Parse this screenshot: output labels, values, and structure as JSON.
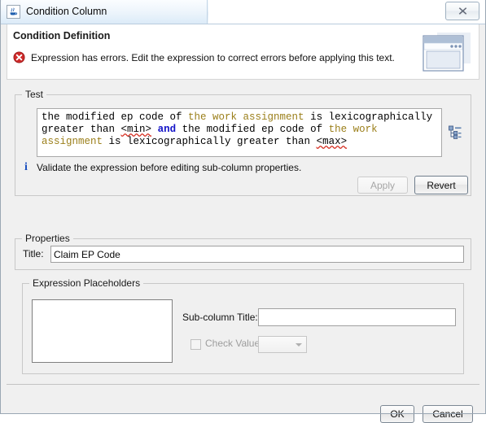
{
  "window": {
    "title": "Condition Column",
    "app_icon": "java-coffee-cup-icon",
    "close_label": "✖"
  },
  "header": {
    "title": "Condition Definition",
    "message": "Expression has errors. Edit the expression to correct errors before applying this text.",
    "message_icon": "error-circle-icon",
    "illustration_icon": "dialog-window-icon"
  },
  "test_group": {
    "legend": "Test",
    "expression_plain_text": "the modified ep code of the work assignment is lexicographically greater than <min> and the modified ep code of the work assignment is lexicographically greater than <max>",
    "expression_tokens": [
      {
        "text": "the modified ep code of ",
        "kind": "plain"
      },
      {
        "text": "the work assignment",
        "kind": "entity"
      },
      {
        "text": " is lexicographically greater than ",
        "kind": "plain"
      },
      {
        "text": "<min>",
        "kind": "error"
      },
      {
        "text": " ",
        "kind": "plain"
      },
      {
        "text": "and",
        "kind": "keyword"
      },
      {
        "text": " the modified ep code of ",
        "kind": "plain"
      },
      {
        "text": "the work assignment",
        "kind": "entity"
      },
      {
        "text": " is lexicographically greater than ",
        "kind": "plain"
      },
      {
        "text": "<max>",
        "kind": "error"
      }
    ],
    "tree_icon": "expression-tree-icon",
    "validate_icon": "info-icon",
    "validate_message": "Validate the expression before editing sub-column properties.",
    "apply_label": "Apply",
    "apply_enabled": false,
    "revert_label": "Revert",
    "revert_enabled": true
  },
  "properties_group": {
    "legend": "Properties",
    "title_label": "Title:",
    "title_value": "Claim EP Code",
    "title_placeholder": ""
  },
  "placeholders_group": {
    "legend": "Expression Placeholders",
    "list_items": [],
    "subcolumn_label": "Sub-column Title:",
    "subcolumn_value": "",
    "subcolumn_placeholder": "",
    "check_value_label": "Check Value",
    "check_value_checked": false,
    "check_value_enabled": false,
    "value_combo_selected": "",
    "value_combo_enabled": false,
    "combo_arrow_icon": "chevron-down-icon"
  },
  "footer": {
    "ok_label": "OK",
    "cancel_label": "Cancel"
  },
  "colors": {
    "error_red": "#d52b1e",
    "keyword_blue": "#1414c8",
    "entity_gold": "#9b7f1a",
    "info_blue": "#1a4fbf",
    "dialog_background": "#f0f0f0",
    "titlebar_blue": "#e8f1fa"
  }
}
